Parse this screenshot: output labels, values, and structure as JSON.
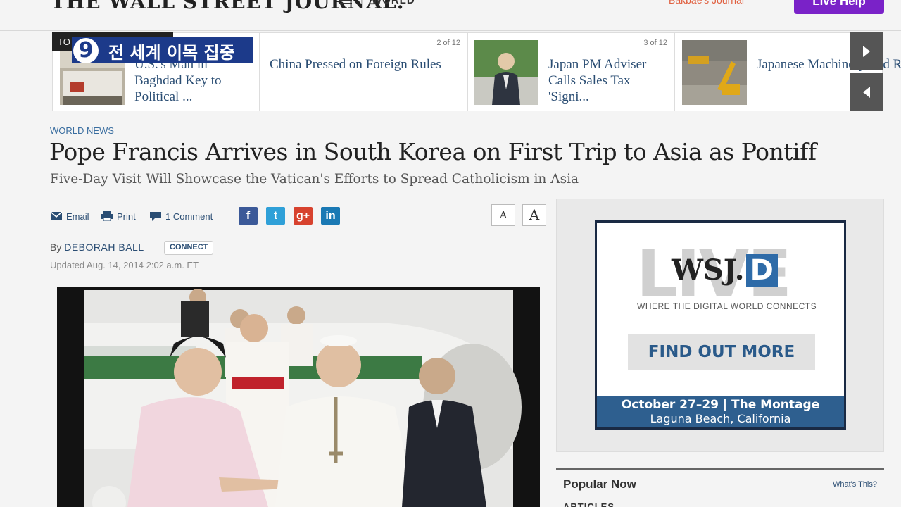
{
  "header": {
    "logo": "THE WALL STREET JOURNAL.",
    "section": "WORLD",
    "journal_link": "Bakbae's Journal",
    "live_help": "Live Help"
  },
  "broadcast": {
    "top_label": "TO",
    "channel_number": "9",
    "title": "전 세계 이목 집중"
  },
  "carousel": {
    "items": [
      {
        "title": "U.S.'s Man in Baghdad Key to Political ...",
        "count": ""
      },
      {
        "title": "China Pressed on Foreign Rules",
        "count": "2 of 12"
      },
      {
        "title": "Japan PM Adviser Calls Sales Tax 'Signi...",
        "count": "3 of 12"
      },
      {
        "title": "Japanese Machinery Ord Rise",
        "count": ""
      }
    ],
    "next_icon": "chevron-right-icon",
    "prev_icon": "chevron-left-icon"
  },
  "article": {
    "kicker": "WORLD NEWS",
    "headline": "Pope Francis Arrives in South Korea on First Trip to Asia as Pontiff",
    "deck": "Five-Day Visit Will Showcase the Vatican's Efforts to Spread Catholicism in Asia",
    "share": {
      "email": "Email",
      "print": "Print",
      "comments": "1 Comment"
    },
    "social": {
      "facebook": "f",
      "twitter": "t",
      "googleplus": "g+",
      "linkedin": "in"
    },
    "font_small": "A",
    "font_large": "A",
    "byline_prefix": "By",
    "author": "DEBORAH BALL",
    "connect": "CONNECT",
    "updated": "Updated Aug. 14, 2014 2:02 a.m. ET"
  },
  "ad": {
    "live": "LIVE",
    "wsj": "WSJ.",
    "d": "D",
    "tagline": "WHERE THE DIGITAL WORLD CONNECTS",
    "cta": "FIND OUT MORE",
    "footer_line1": "October 27–29 | The Montage",
    "footer_line2": "Laguna Beach, California"
  },
  "popular": {
    "title": "Popular Now",
    "whats_this": "What's This?",
    "articles": "ARTICLES"
  },
  "colors": {
    "link": "#2a4d73",
    "live_help": "#7a22c8",
    "broadcast_blue": "#1c3a8a",
    "ad_footer": "#2e5f8f"
  }
}
